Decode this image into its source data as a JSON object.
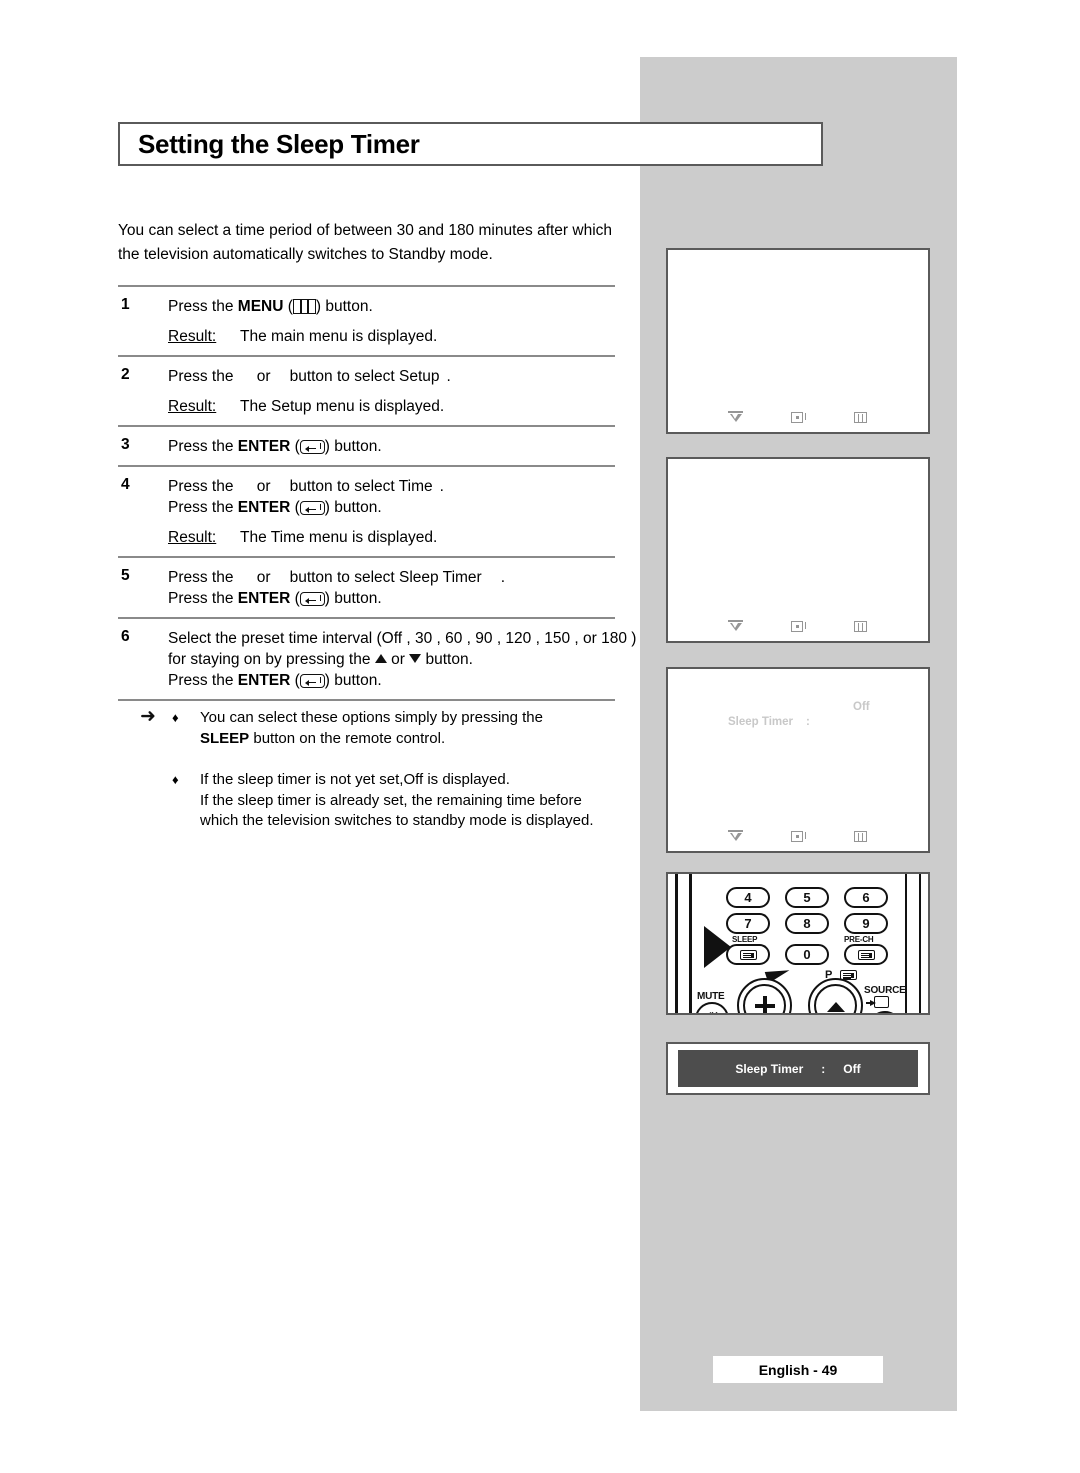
{
  "page": {
    "title": "Setting the Sleep Timer",
    "intro": "You can select a time period of between 30 and 180 minutes after which the television automatically switches to Standby mode.",
    "footer": "English - 49"
  },
  "steps": [
    {
      "num": "1",
      "line1_a": "Press the ",
      "line1_b": "MENU",
      "line1_c": " (",
      "line1_d": ") button.",
      "result_label": "Result:",
      "result_text": "The main menu is displayed."
    },
    {
      "num": "2",
      "line1_a": "Press the ",
      "line1_or": "or",
      "line1_b": "button to select Setup",
      "line1_c": ".",
      "result_label": "Result:",
      "result_text": "The Setup  menu is displayed."
    },
    {
      "num": "3",
      "line1_a": "Press the ",
      "line1_b": "ENTER",
      "line1_c": " (",
      "line1_d": ") button."
    },
    {
      "num": "4",
      "line1_a": "Press the ",
      "line1_or": "or",
      "line1_b": "button to select Time",
      "line1_c": ".",
      "line2_a": "Press the ",
      "line2_b": "ENTER",
      "line2_c": " (",
      "line2_d": ") button.",
      "result_label": "Result:",
      "result_text": "The Time  menu is displayed."
    },
    {
      "num": "5",
      "line1_a": "Press the ",
      "line1_or": "or",
      "line1_b": "button to select Sleep Timer",
      "line1_c": ".",
      "line2_a": "Press the ",
      "line2_b": "ENTER",
      "line2_c": " (",
      "line2_d": ") button."
    },
    {
      "num": "6",
      "line1": "Select the preset time interval (Off , 30 , 60 , 90 , 120 , 150 , or 180 )",
      "line2_a": "for staying on by pressing the ",
      "line2_b": " or ",
      "line2_c": " button.",
      "line3_a": "Press the ",
      "line3_b": "ENTER",
      "line3_c": " (",
      "line3_d": ") button."
    }
  ],
  "notes": {
    "arrow_glyph": "➜",
    "bullet_glyph": "♦",
    "items": [
      {
        "line1": "You can select these options simply by pressing the",
        "line2_bold": "SLEEP",
        "line2_rest": " button on the remote control."
      },
      {
        "line1_a": "If the sleep timer is not yet set,",
        "line1_b": "Off",
        "line1_c": "  is displayed.",
        "line2": "If the sleep timer is already set, the remaining time before",
        "line3": "which the television switches to standby mode is displayed."
      }
    ]
  },
  "osd_screens": [
    {
      "name": "main-menu-screen",
      "label": "",
      "colon": "",
      "value": ""
    },
    {
      "name": "setup-menu-screen",
      "label": "",
      "colon": "",
      "value": ""
    },
    {
      "name": "time-menu-screen",
      "label": "Sleep Timer",
      "colon": ":",
      "value": "Off"
    }
  ],
  "osd_nav": {
    "move_icon": "move-icon",
    "enter_icon": "enter-icon",
    "return_icon": "return-icon"
  },
  "osd_bar": {
    "label": "Sleep Timer",
    "colon": ":",
    "value": "Off"
  },
  "remote": {
    "keys": [
      {
        "label": "4"
      },
      {
        "label": "5"
      },
      {
        "label": "6"
      },
      {
        "label": "7"
      },
      {
        "label": "8"
      },
      {
        "label": "9"
      },
      {
        "label": "0"
      }
    ],
    "sleep_label": "SLEEP",
    "prech_label": "PRE-CH",
    "mute_label": "MUTE",
    "source_label": "SOURCE",
    "p_label": "P"
  },
  "colors": {
    "sidebar_grey": "#cccccc",
    "osd_bar_dark": "#4d4d4d",
    "osd_faint_text": "#c8c8c8",
    "rule_grey": "#8a8a8a",
    "border_grey": "#5a5a5a"
  }
}
